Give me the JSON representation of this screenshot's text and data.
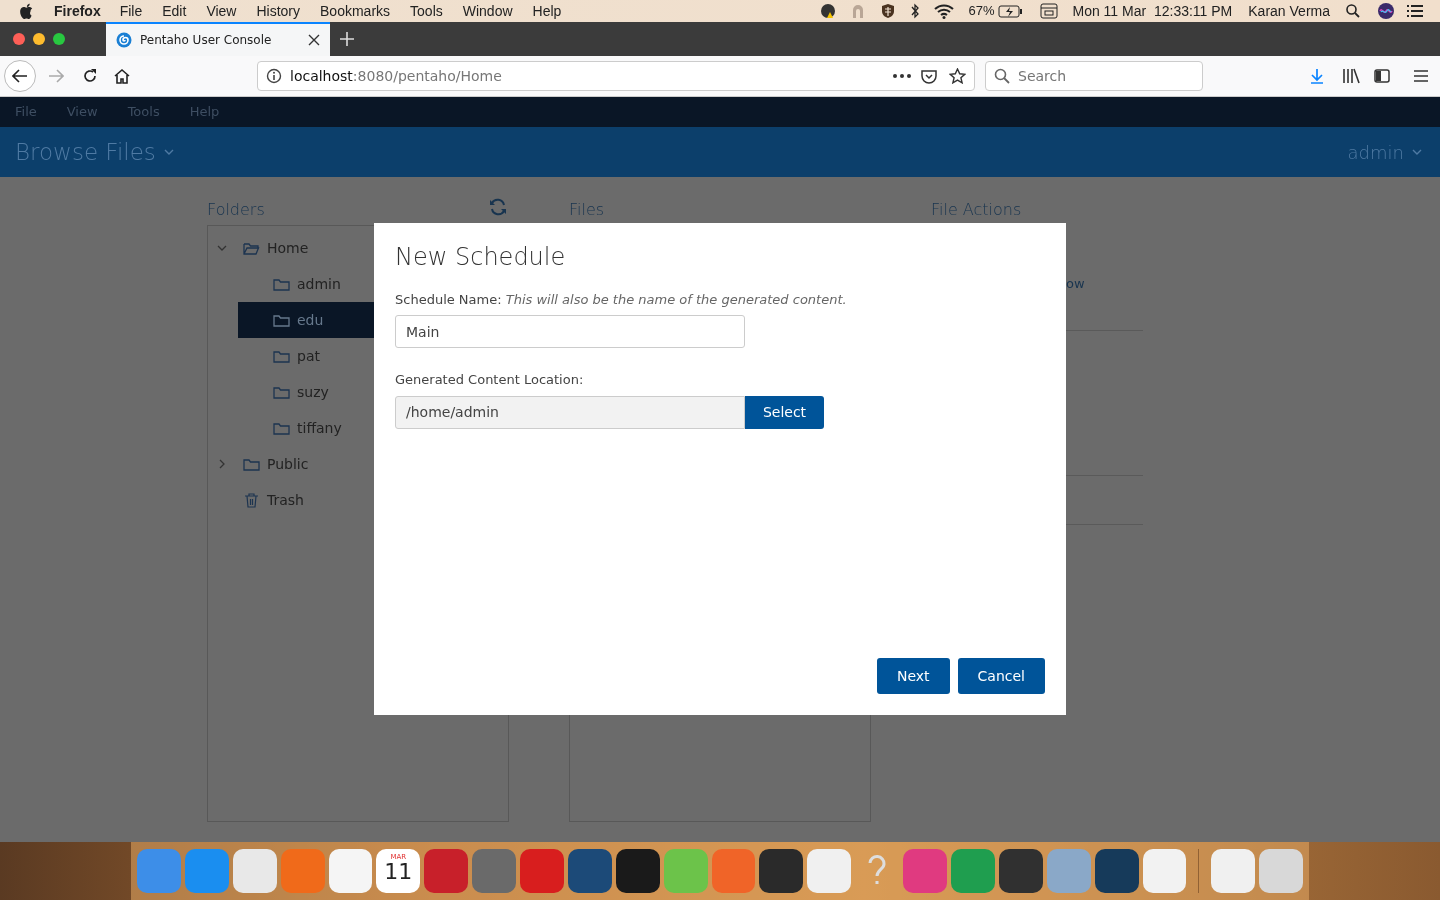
{
  "os_menu_bar": {
    "app": "Firefox",
    "menus": [
      "File",
      "Edit",
      "View",
      "History",
      "Bookmarks",
      "Tools",
      "Window",
      "Help"
    ],
    "battery": "67%",
    "datetime": "Mon 11 Mar  12:33:11 PM",
    "user": "Karan Verma"
  },
  "browser": {
    "tabs": [
      {
        "title": "Pentaho User Console",
        "selected": true
      }
    ],
    "url_host": "localhost",
    "url_path": ":8080/pentaho/Home",
    "search_placeholder": "Search"
  },
  "app": {
    "menus": [
      "File",
      "View",
      "Tools",
      "Help"
    ],
    "perspective": "Browse Files",
    "user": "admin",
    "folders_title": "Folders",
    "files_title": "Files",
    "file_actions_title": "File Actions",
    "file_actions_visible_text": "ow",
    "tree": [
      {
        "label": "Home",
        "kind": "folder",
        "expanded": true,
        "selected": false,
        "children": [
          {
            "label": "admin",
            "kind": "folder",
            "selected": false
          },
          {
            "label": "edu",
            "kind": "folder",
            "selected": true
          },
          {
            "label": "pat",
            "kind": "folder",
            "selected": false
          },
          {
            "label": "suzy",
            "kind": "folder",
            "selected": false
          },
          {
            "label": "tiffany",
            "kind": "folder",
            "selected": false
          }
        ]
      },
      {
        "label": "Public",
        "kind": "folder",
        "expanded": false,
        "selected": false
      },
      {
        "label": "Trash",
        "kind": "trash",
        "selected": false
      }
    ]
  },
  "dialog": {
    "title": "New Schedule",
    "name_label": "Schedule Name:",
    "name_hint": "This will also be the name of the generated content.",
    "name_value": "Main",
    "location_label": "Generated Content Location:",
    "location_value": "/home/admin",
    "select_button": "Select",
    "buttons": [
      {
        "label": "Next"
      },
      {
        "label": "Cancel"
      }
    ]
  },
  "dock": {
    "calendar_month": "MAR",
    "calendar_day": "11"
  }
}
